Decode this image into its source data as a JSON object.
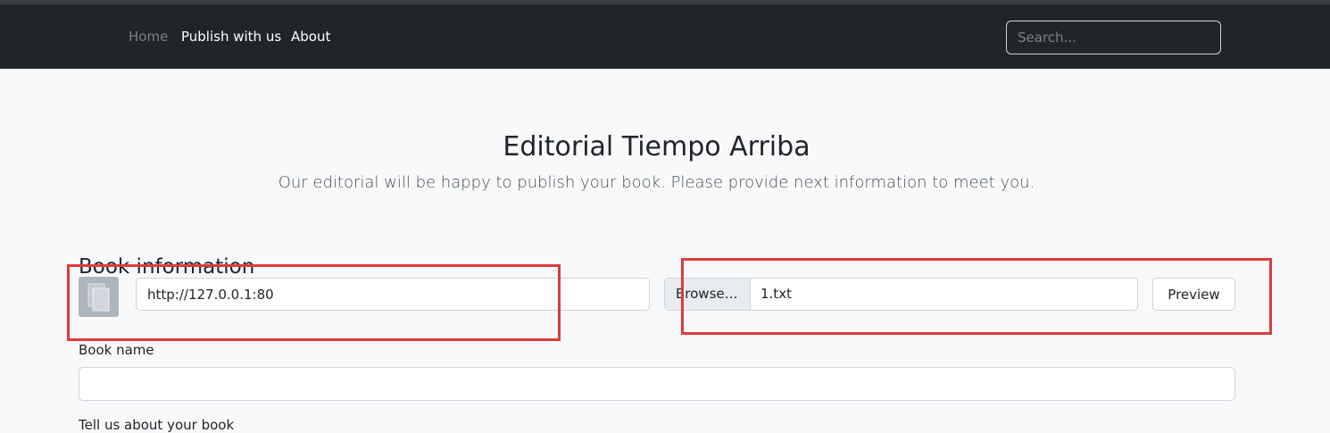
{
  "navbar": {
    "links": [
      {
        "label": "Home"
      },
      {
        "label": "Publish with us"
      },
      {
        "label": "About"
      }
    ],
    "search": {
      "placeholder": "Search..."
    }
  },
  "header": {
    "title": "Editorial Tiempo Arriba",
    "lead": "Our editorial will be happy to publish your book. Please provide next information to meet you."
  },
  "book_info": {
    "section_title": "Book information",
    "cover_icon": "file-copy-icon",
    "url_value": "http://127.0.0.1:80",
    "file": {
      "browse_label": "Browse…",
      "file_name": "1.txt"
    },
    "preview_label": "Preview",
    "book_name_label": "Book name",
    "book_name_value": "",
    "about_label": "Tell us about your book"
  },
  "colors": {
    "navbar_bg": "#212529",
    "page_bg": "#f8f9fa",
    "highlight": "#dc3c3c"
  }
}
